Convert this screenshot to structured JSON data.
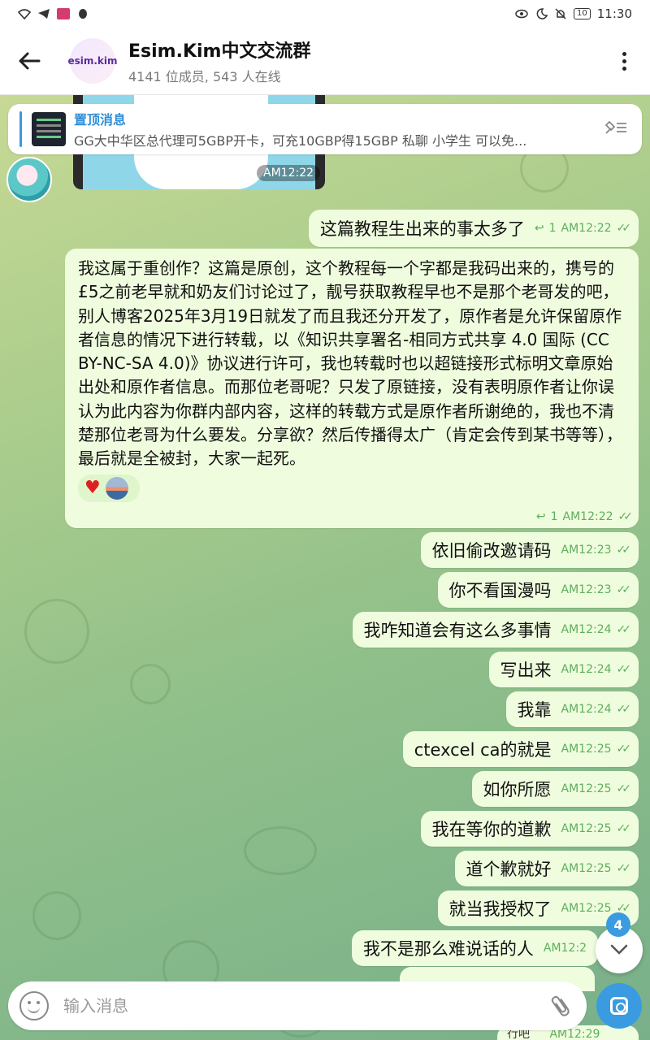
{
  "status_bar": {
    "time": "11:30",
    "battery": "10"
  },
  "header": {
    "avatar_text": "esim.kim",
    "title": "Esim.Kim中文交流群",
    "subtitle": "4141 位成员, 543 人在线"
  },
  "pinned": {
    "title": "置顶消息",
    "text": "GG大中华区总代理可5GBP开卡，可充10GBP得15GBP 私聊 小学生 可以免..."
  },
  "media": {
    "time": "AM12:22"
  },
  "messages": [
    {
      "text": "这篇教程生出来的事太多了",
      "replies": "1",
      "time": "AM12:22"
    },
    {
      "text": "依旧偷改邀请码",
      "time": "AM12:23"
    },
    {
      "text": "你不看国漫吗",
      "time": "AM12:23"
    },
    {
      "text": "我咋知道会有这么多事情",
      "time": "AM12:24"
    },
    {
      "text": "写出来",
      "time": "AM12:24"
    },
    {
      "text": "我靠",
      "time": "AM12:24"
    },
    {
      "text": "ctexcel ca的就是",
      "time": "AM12:25"
    },
    {
      "text": "如你所愿",
      "time": "AM12:25"
    },
    {
      "text": "我在等你的道歉",
      "time": "AM12:25"
    },
    {
      "text": "道个歉就好",
      "time": "AM12:25"
    },
    {
      "text": "就当我授权了",
      "time": "AM12:25"
    },
    {
      "text": "我不是那么难说话的人",
      "time": "AM12:2"
    }
  ],
  "long_message": {
    "text": "我这属于重创作？这篇是原创，这个教程每一个字都是我码出来的，携号的£5之前老早就和奶友们讨论过了，靓号获取教程早也不是那个老哥发的吧，别人博客2025年3月19日就发了而且我还分开发了，原作者是允许保留原作者信息的情况下进行转载，以《知识共享署名-相同方式共享 4.0 国际 (CC BY-NC-SA 4.0)》协议进行许可，我也转载时也以超链接形式标明文章原始出处和原作者信息。而那位老哥呢？只发了原链接，没有表明原作者让你误认为此内容为你群内部内容，这样的转载方式是原作者所谢绝的，我也不清楚那位老哥为什么要发。分享欲？然后传播得太广（肯定会传到某书等等），最后就是全被封，大家一起死。",
    "replies": "1",
    "time": "AM12:22"
  },
  "partial_bottom": {
    "text": "行吧",
    "time": "AM12:29"
  },
  "scroll_fab": {
    "badge": "4"
  },
  "input": {
    "placeholder": "输入消息"
  },
  "colors": {
    "accent": "#3a9be0",
    "bubble_out": "#effdde",
    "check": "#5dae5d"
  },
  "icons": [
    "back-arrow-icon",
    "more-vert-icon",
    "pin-off-icon",
    "emoji-icon",
    "attach-icon",
    "camera-icon",
    "chevron-down-icon",
    "double-check-icon",
    "reply-icon"
  ]
}
